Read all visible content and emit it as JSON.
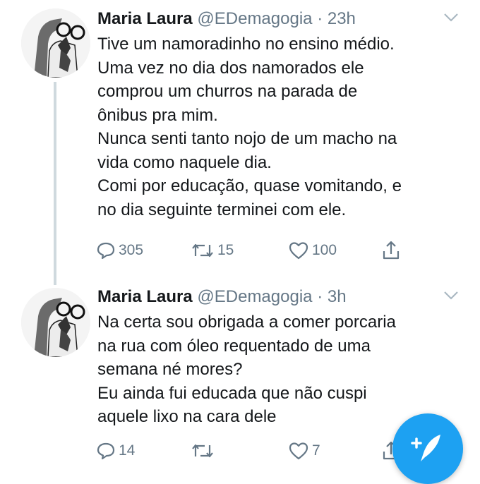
{
  "tweets": [
    {
      "author": {
        "name": "Maria Laura",
        "handle": "@EDemagogia",
        "separator": "·",
        "time": "23h"
      },
      "lines": [
        "Tive um namoradinho no ensino médio.",
        "Uma vez no dia dos namorados ele",
        "comprou um churros na parada de",
        "ônibus pra mim.",
        "Nunca senti tanto nojo de um macho na",
        "vida como naquele dia.",
        "Comi por educação, quase vomitando, e",
        "no dia seguinte terminei com ele."
      ],
      "stats": {
        "replies": "305",
        "retweets": "15",
        "likes": "100"
      }
    },
    {
      "author": {
        "name": "Maria Laura",
        "handle": "@EDemagogia",
        "separator": "·",
        "time": "3h"
      },
      "lines": [
        "Na certa sou obrigada a comer porcaria",
        "na rua com óleo requentado de uma",
        "semana né mores?",
        "Eu ainda fui educada que não cuspi",
        "aquele lixo na cara dele"
      ],
      "stats": {
        "replies": "14",
        "retweets": "",
        "likes": "7"
      }
    }
  ],
  "icons": {
    "reply": "reply-icon",
    "retweet": "retweet-icon",
    "like": "heart-icon",
    "share": "share-icon",
    "more": "chevron-down-icon",
    "compose": "compose-tweet-icon"
  },
  "colors": {
    "accent": "#1da1f2",
    "text": "#14171a",
    "muted": "#657786",
    "thread": "#cfd9de"
  }
}
